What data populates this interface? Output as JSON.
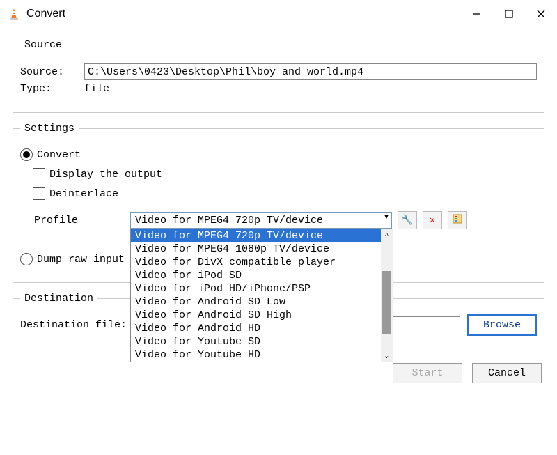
{
  "window": {
    "title": "Convert"
  },
  "source": {
    "legend": "Source",
    "source_label": "Source:",
    "source_value": "C:\\Users\\0423\\Desktop\\Phil\\boy and world.mp4",
    "type_label": "Type:",
    "type_value": "file"
  },
  "settings": {
    "legend": "Settings",
    "convert_label": "Convert",
    "display_output_label": "Display the output",
    "deinterlace_label": "Deinterlace",
    "profile_label": "Profile",
    "profile_selected": "Video for MPEG4 720p TV/device",
    "profile_options": [
      "Video for MPEG4 720p TV/device",
      "Video for MPEG4 1080p TV/device",
      "Video for DivX compatible player",
      "Video for iPod SD",
      "Video for iPod HD/iPhone/PSP",
      "Video for Android SD Low",
      "Video for Android SD High",
      "Video for Android HD",
      "Video for Youtube SD",
      "Video for Youtube HD"
    ],
    "dump_raw_label": "Dump raw input"
  },
  "destination": {
    "legend": "Destination",
    "file_label": "Destination file:",
    "browse_label": "Browse"
  },
  "buttons": {
    "start": "Start",
    "cancel": "Cancel"
  }
}
